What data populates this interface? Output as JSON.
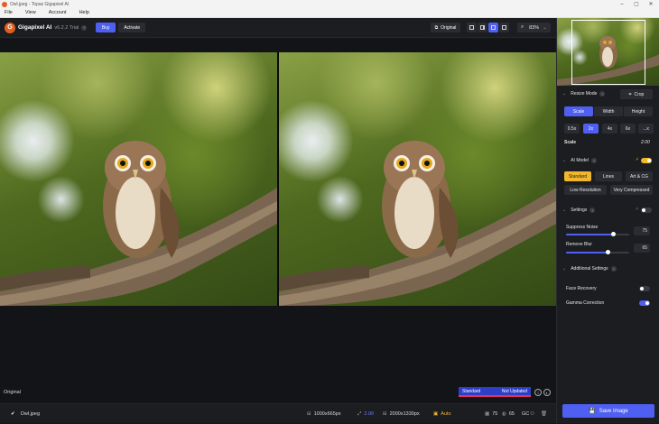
{
  "window": {
    "title": "Owl.jpeg - Topaz Gigapixel AI"
  },
  "menu": [
    "File",
    "View",
    "Account",
    "Help"
  ],
  "toolbar": {
    "app_name": "Gigapixel AI",
    "version": "v6.2.2 Trial",
    "buy_label": "Buy",
    "activate_label": "Activate",
    "original_label": "Original",
    "zoom": "83%"
  },
  "canvas": {
    "label": "Original",
    "status_model": "Standard",
    "status_state": "Not Updated"
  },
  "bottom": {
    "filename": "Owl.jpeg",
    "input_size": "1000x665px",
    "scale": "2.00",
    "output_size": "2000x1330px",
    "mode": "Auto",
    "quality": "75",
    "count": "65",
    "gc": "GC"
  },
  "sidebar": {
    "resize_mode_label": "Resize Mode",
    "crop_label": "Crop",
    "resize_tabs": [
      "Scale",
      "Width",
      "Height"
    ],
    "scale_options": [
      "0.5x",
      "2x",
      "4x",
      "6x",
      "...x"
    ],
    "scale_label": "Scale",
    "scale_value": "2.00",
    "ai_model_label": "AI Model",
    "models_row1": [
      "Standard",
      "Lines",
      "Art & CG"
    ],
    "models_row2": [
      "Low Resolution",
      "Very Compressed"
    ],
    "settings_label": "Settings",
    "suppress_noise_label": "Suppress Noise",
    "suppress_noise_value": "75",
    "remove_blur_label": "Remove Blur",
    "remove_blur_value": "65",
    "additional_settings_label": "Additional Settings",
    "face_recovery_label": "Face Recovery",
    "gamma_correction_label": "Gamma Correction",
    "save_label": "Save Image"
  },
  "colors": {
    "accent": "#4f5ff2",
    "brand": "#e2601d",
    "gold": "#f2b62c"
  }
}
